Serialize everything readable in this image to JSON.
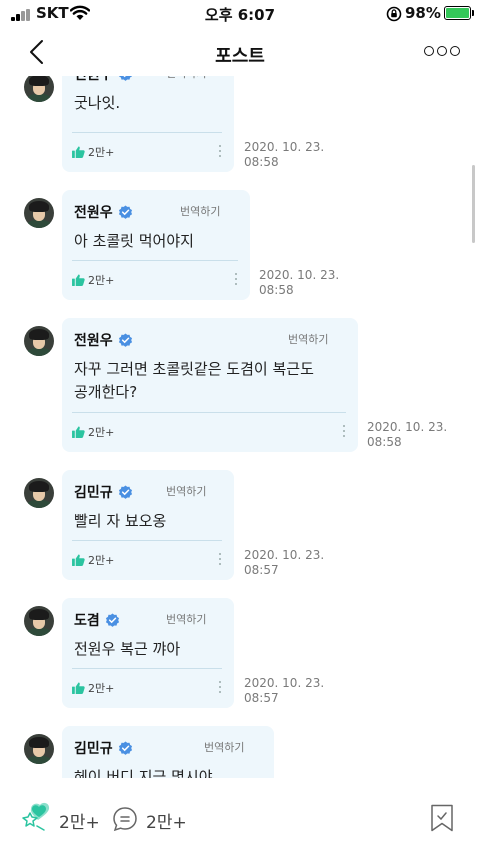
{
  "status_bar": {
    "carrier": "SKT",
    "time": "오후 6:07",
    "battery": "98%"
  },
  "nav": {
    "title": "포스트"
  },
  "translate_label": "번역하기",
  "messages": [
    {
      "author": "전원우",
      "text": "굿나잇.",
      "likes": "2만+",
      "date": "2020. 10. 23.",
      "time": "08:58"
    },
    {
      "author": "전원우",
      "text": "아 초콜릿 먹어야지",
      "likes": "2만+",
      "date": "2020. 10. 23.",
      "time": "08:58"
    },
    {
      "author": "전원우",
      "text_line1": "자꾸 그러면 초콜릿같은 도겸이 복근도",
      "text_line2": "공개한다?",
      "likes": "2만+",
      "date": "2020. 10. 23.",
      "time": "08:58"
    },
    {
      "author": "김민규",
      "text": "빨리 자 뵤오옹",
      "likes": "2만+",
      "date": "2020. 10. 23.",
      "time": "08:57"
    },
    {
      "author": "도겸",
      "text": "전원우 복근 꺄아",
      "likes": "2만+",
      "date": "2020. 10. 23.",
      "time": "08:57"
    },
    {
      "author": "김민규",
      "text": "헤이 버디 지금 몇시야"
    }
  ],
  "bottom_bar": {
    "like_count": "2만+",
    "comment_count": "2만+"
  },
  "colors": {
    "bubble_bg": "#eef7fc",
    "verified": "#4a90e2",
    "like_green": "#2bc4a0",
    "battery_green": "#34c759"
  }
}
